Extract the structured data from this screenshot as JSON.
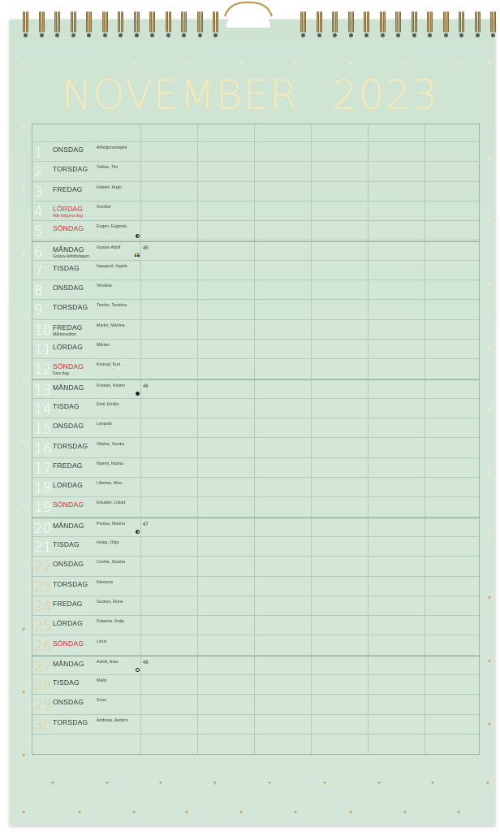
{
  "calendar": {
    "month": "NOVEMBER",
    "year": "2023"
  },
  "days": [
    {
      "num": "1",
      "name": "ONSDAG",
      "names": "Alhelgonadagen",
      "holiday": "",
      "red": false,
      "week": ""
    },
    {
      "num": "2",
      "name": "TORSDAG",
      "names": "Tobias, Tim",
      "holiday": "",
      "red": false,
      "week": ""
    },
    {
      "num": "3",
      "name": "FREDAG",
      "names": "Hubert, Hugo",
      "holiday": "",
      "red": false,
      "week": ""
    },
    {
      "num": "4",
      "name": "LÖRDAG",
      "names": "Sverker",
      "holiday": "Alla helgons dag",
      "red": true,
      "week": ""
    },
    {
      "num": "5",
      "name": "SÖNDAG",
      "names": "Eugen, Eugenia",
      "holiday": "",
      "red": true,
      "week": ""
    },
    {
      "num": "6",
      "name": "MÅNDAG",
      "names": "Gustav Adolf",
      "holiday": "Gustav Adolfsdagen",
      "red": false,
      "week": "45"
    },
    {
      "num": "7",
      "name": "TISDAG",
      "names": "Ingegerd, Ingela",
      "holiday": "",
      "red": false,
      "week": ""
    },
    {
      "num": "8",
      "name": "ONSDAG",
      "names": "Vendela",
      "holiday": "",
      "red": false,
      "week": ""
    },
    {
      "num": "9",
      "name": "TORSDAG",
      "names": "Teodor, Teodora",
      "holiday": "",
      "red": false,
      "week": ""
    },
    {
      "num": "10",
      "name": "FREDAG",
      "names": "Martin, Martina",
      "holiday": "Mårtensafton",
      "red": false,
      "week": ""
    },
    {
      "num": "11",
      "name": "LÖRDAG",
      "names": "Mårten",
      "holiday": "",
      "red": false,
      "week": ""
    },
    {
      "num": "12",
      "name": "SÖNDAG",
      "names": "Konrad, Kurt",
      "holiday": "Fars dag",
      "red": true,
      "week": ""
    },
    {
      "num": "13",
      "name": "MÅNDAG",
      "names": "Kristian, Krister",
      "holiday": "",
      "red": false,
      "week": "46"
    },
    {
      "num": "14",
      "name": "TISDAG",
      "names": "Emil, Emilia",
      "holiday": "",
      "red": false,
      "week": ""
    },
    {
      "num": "15",
      "name": "ONSDAG",
      "names": "Leopold",
      "holiday": "",
      "red": false,
      "week": ""
    },
    {
      "num": "16",
      "name": "TORSDAG",
      "names": "Vibeke, Viveka",
      "holiday": "",
      "red": false,
      "week": ""
    },
    {
      "num": "17",
      "name": "FREDAG",
      "names": "Naemi, Naima",
      "holiday": "",
      "red": false,
      "week": ""
    },
    {
      "num": "18",
      "name": "LÖRDAG",
      "names": "Lillemor, Moa",
      "holiday": "",
      "red": false,
      "week": ""
    },
    {
      "num": "19",
      "name": "SÖNDAG",
      "names": "Elisabet, Lisbet",
      "holiday": "",
      "red": true,
      "week": ""
    },
    {
      "num": "20",
      "name": "MÅNDAG",
      "names": "Pontus, Marina",
      "holiday": "",
      "red": false,
      "week": "47"
    },
    {
      "num": "21",
      "name": "TISDAG",
      "names": "Helga, Olga",
      "holiday": "",
      "red": false,
      "week": ""
    },
    {
      "num": "22",
      "name": "ONSDAG",
      "names": "Cecilia, Sissela",
      "holiday": "",
      "red": false,
      "week": ""
    },
    {
      "num": "23",
      "name": "TORSDAG",
      "names": "Klemens",
      "holiday": "",
      "red": false,
      "week": ""
    },
    {
      "num": "24",
      "name": "FREDAG",
      "names": "Gudrun, Rune",
      "holiday": "",
      "red": false,
      "week": ""
    },
    {
      "num": "25",
      "name": "LÖRDAG",
      "names": "Katarina, Katja",
      "holiday": "",
      "red": false,
      "week": ""
    },
    {
      "num": "26",
      "name": "SÖNDAG",
      "names": "Linus",
      "holiday": "",
      "red": true,
      "week": ""
    },
    {
      "num": "27",
      "name": "MÅNDAG",
      "names": "Astrid, Asta",
      "holiday": "",
      "red": false,
      "week": "48"
    },
    {
      "num": "28",
      "name": "TISDAG",
      "names": "Malte",
      "holiday": "",
      "red": false,
      "week": ""
    },
    {
      "num": "29",
      "name": "ONSDAG",
      "names": "Sune",
      "holiday": "",
      "red": false,
      "week": ""
    },
    {
      "num": "30",
      "name": "TORSDAG",
      "names": "Andreas, Anders",
      "holiday": "",
      "red": false,
      "week": ""
    }
  ],
  "colors": {
    "background": "#d3e6d8",
    "gold": "#c9a961",
    "title": "#f2eabf",
    "sunday_red": "#c8323a",
    "grid_line": "#b5cbb9"
  },
  "icons": {
    "moon_phases": [
      "first-quarter-moon-icon",
      "full-moon-icon",
      "last-quarter-moon-icon",
      "new-moon-icon"
    ],
    "flag": "swedish-flag-icon"
  }
}
